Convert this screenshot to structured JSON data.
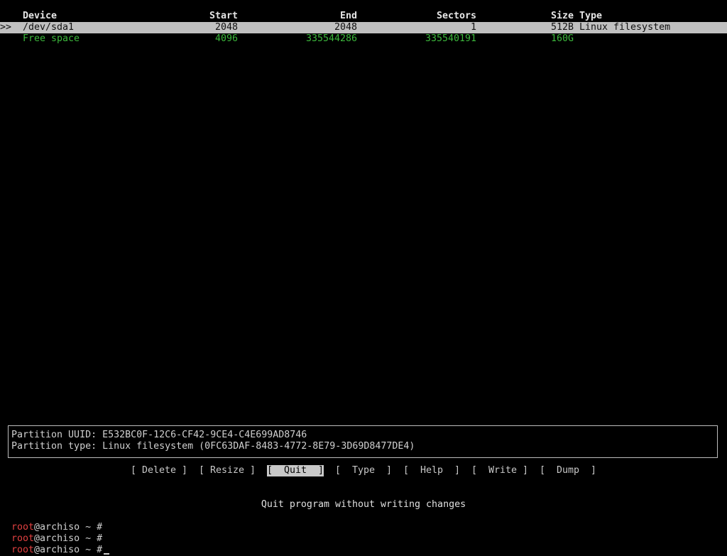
{
  "table": {
    "headers": {
      "device": "Device",
      "start": "Start",
      "end": "End",
      "sectors": "Sectors",
      "size": "Size",
      "type": "Type"
    },
    "selection_marker": ">>",
    "rows": [
      {
        "device": "/dev/sda1",
        "start": "2048",
        "end": "2048",
        "sectors": "1",
        "size": "512B",
        "type": "Linux filesystem"
      },
      {
        "device": "Free space",
        "start": "4096",
        "end": "335544286",
        "sectors": "335540191",
        "size": "160G",
        "type": ""
      }
    ]
  },
  "info": {
    "uuid_line": "Partition UUID: E532BC0F-12C6-CF42-9CE4-C4E699AD8746",
    "type_line": "Partition type: Linux filesystem (0FC63DAF-8483-4772-8E79-3D69D8477DE4)"
  },
  "menu": {
    "delete": "[ Delete ]",
    "resize": "[ Resize ]",
    "quit": "[  Quit  ]",
    "type": "[  Type  ]",
    "help": "[  Help  ]",
    "write": "[  Write ]",
    "dump": "[  Dump  ]",
    "active": "quit"
  },
  "hint": "Quit program without writing changes",
  "shell": {
    "user": "root",
    "rest": "@archiso ~ #",
    "lines": 3
  },
  "colors": {
    "background": "#000000",
    "selected_row_bg": "#c0c0c0",
    "free_space": "#3cb83c",
    "prompt_user": "#e04040"
  }
}
